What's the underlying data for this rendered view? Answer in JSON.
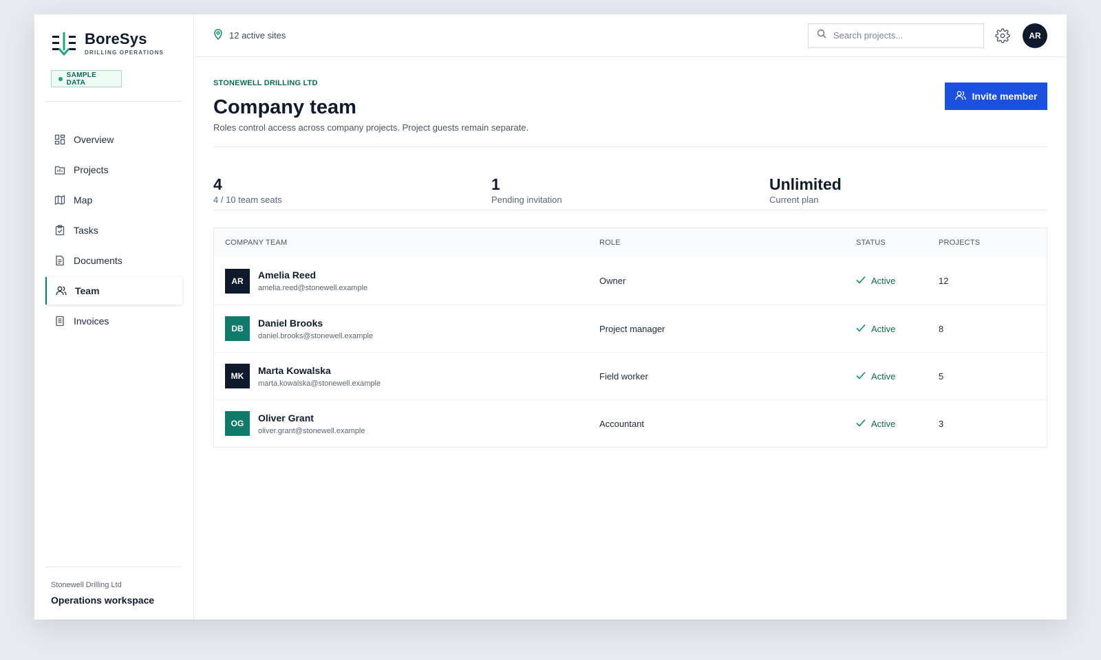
{
  "brand": {
    "name": "BoreSys",
    "tagline": "DRILLING OPERATIONS",
    "badge": "SAMPLE DATA"
  },
  "nav": [
    {
      "label": "Overview",
      "icon": "grid-icon",
      "active": false
    },
    {
      "label": "Projects",
      "icon": "folder-icon",
      "active": false
    },
    {
      "label": "Map",
      "icon": "map-icon",
      "active": false
    },
    {
      "label": "Tasks",
      "icon": "clipboard-icon",
      "active": false
    },
    {
      "label": "Documents",
      "icon": "document-icon",
      "active": false
    },
    {
      "label": "Team",
      "icon": "users-icon",
      "active": true
    },
    {
      "label": "Invoices",
      "icon": "receipt-icon",
      "active": false
    }
  ],
  "sidebar_footer": {
    "org": "Stonewell Drilling Ltd",
    "workspace": "Operations workspace"
  },
  "topbar": {
    "sites": "12 active sites",
    "search_placeholder": "Search projects...",
    "avatar": "AR"
  },
  "page": {
    "company": "STONEWELL DRILLING LTD",
    "title": "Company team",
    "subtitle": "Roles control access across company projects. Project guests remain separate.",
    "invite_label": "Invite member"
  },
  "stats": [
    {
      "value": "4",
      "label": "4 / 10 team seats"
    },
    {
      "value": "1",
      "label": "Pending invitation"
    },
    {
      "value": "Unlimited",
      "label": "Current plan"
    }
  ],
  "table": {
    "headers": {
      "member": "COMPANY TEAM",
      "role": "ROLE",
      "status": "STATUS",
      "projects": "PROJECTS"
    },
    "rows": [
      {
        "initials": "AR",
        "name": "Amelia Reed",
        "email": "amelia.reed@stonewell.example",
        "role": "Owner",
        "status": "Active",
        "projects": "12",
        "avatar_color": "#0f1b2d"
      },
      {
        "initials": "DB",
        "name": "Daniel Brooks",
        "email": "daniel.brooks@stonewell.example",
        "role": "Project manager",
        "status": "Active",
        "projects": "8",
        "avatar_color": "#0d7a6a"
      },
      {
        "initials": "MK",
        "name": "Marta Kowalska",
        "email": "marta.kowalska@stonewell.example",
        "role": "Field worker",
        "status": "Active",
        "projects": "5",
        "avatar_color": "#0f1b2d"
      },
      {
        "initials": "OG",
        "name": "Oliver Grant",
        "email": "oliver.grant@stonewell.example",
        "role": "Accountant",
        "status": "Active",
        "projects": "3",
        "avatar_color": "#0d7a6a"
      }
    ]
  },
  "colors": {
    "accent": "#1a4fe0",
    "brand_green": "#0b6b52",
    "dark": "#0f1b2d"
  }
}
